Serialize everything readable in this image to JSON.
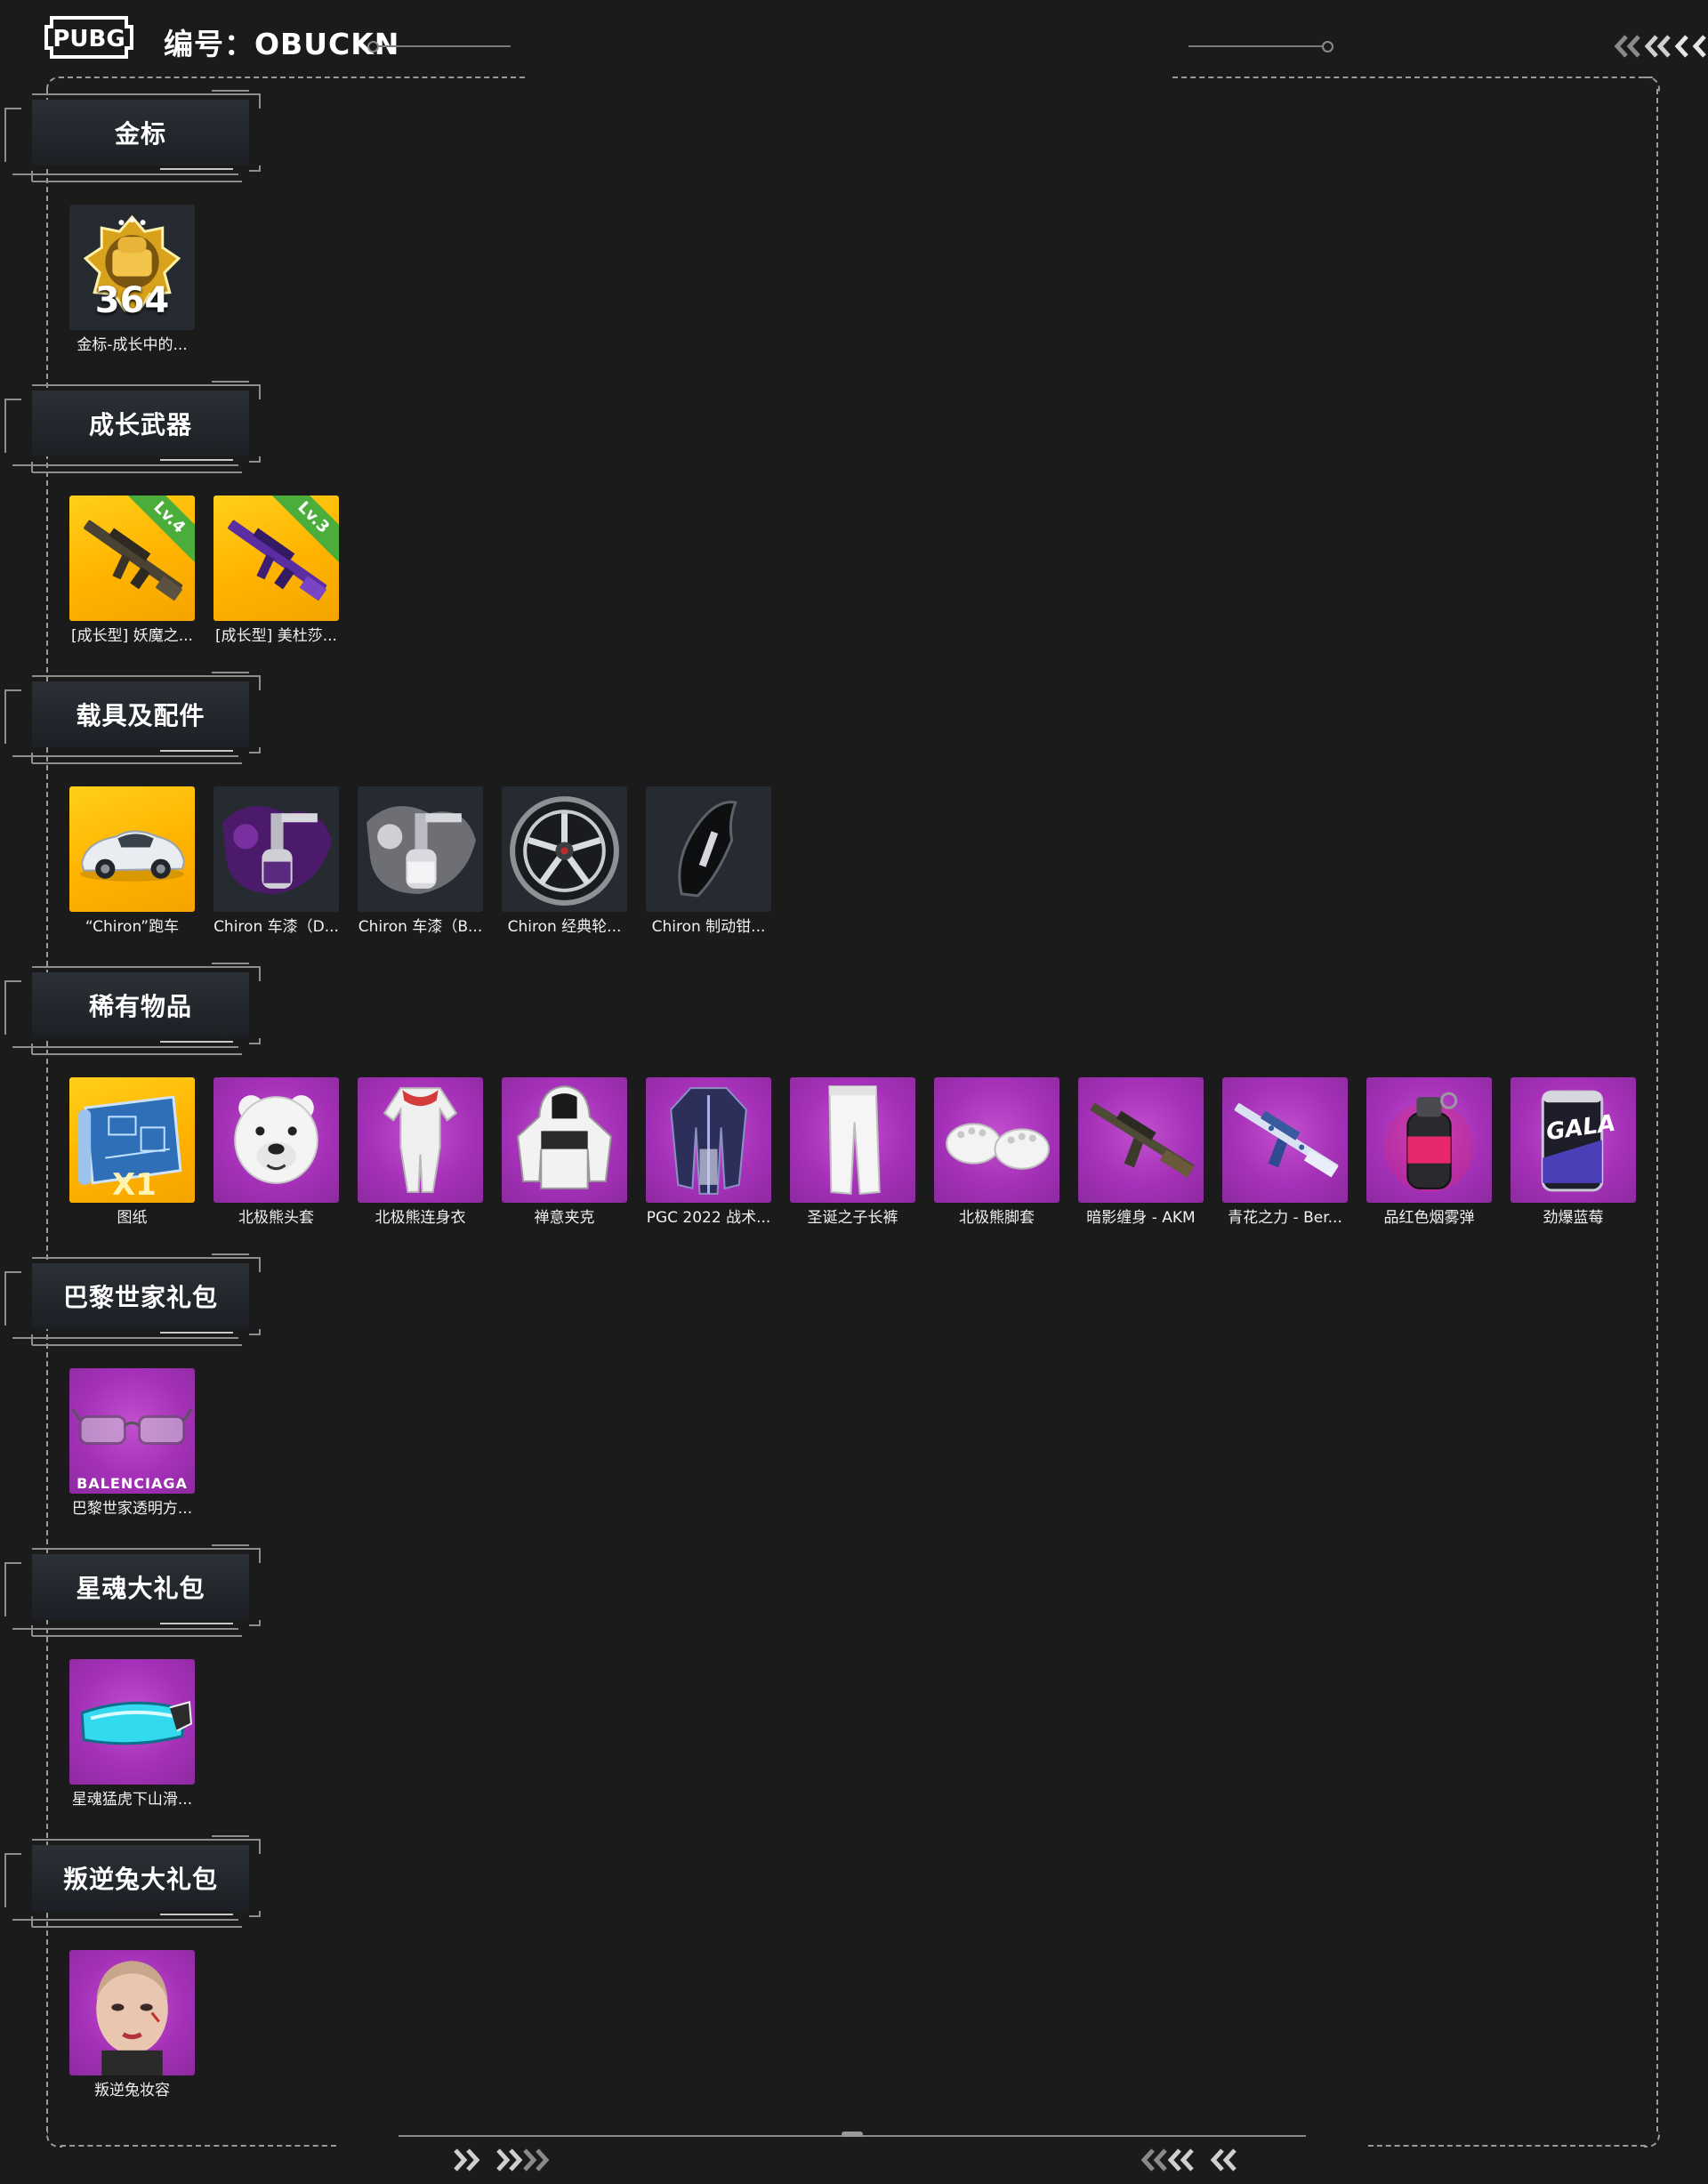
{
  "header": {
    "logo_text": "PUBG",
    "code_label": "编号：OBUCKN"
  },
  "colors": {
    "background": "#1b1b1c",
    "gold_tile": "#ffb300",
    "purple_tile": "#a531b8",
    "dark_tile": "#262b31",
    "level_badge": "#4cae3a"
  },
  "sections": [
    {
      "title": "金标",
      "items": [
        {
          "label": "金标-成长中的...",
          "bg": "dark",
          "icon": "gold-badge-icon",
          "badge_number": "364"
        }
      ]
    },
    {
      "title": "成长武器",
      "items": [
        {
          "label": "[成长型] 妖魔之...",
          "bg": "gold",
          "icon": "rifle-icon",
          "level": "Lv.4"
        },
        {
          "label": "[成长型] 美杜莎...",
          "bg": "gold",
          "icon": "rifle-purple-icon",
          "level": "Lv.3"
        }
      ]
    },
    {
      "title": "载具及配件",
      "items": [
        {
          "label": "“Chiron”跑车",
          "bg": "gold",
          "icon": "sports-car-icon"
        },
        {
          "label": "Chiron 车漆（D...",
          "bg": "dark",
          "icon": "paint-sprayer-purple-icon"
        },
        {
          "label": "Chiron 车漆（B...",
          "bg": "dark",
          "icon": "paint-sprayer-white-icon"
        },
        {
          "label": "Chiron 经典轮...",
          "bg": "dark",
          "icon": "wheel-rim-icon"
        },
        {
          "label": "Chiron 制动钳...",
          "bg": "dark",
          "icon": "brake-caliper-icon"
        }
      ]
    },
    {
      "title": "稀有物品",
      "items": [
        {
          "label": "图纸",
          "bg": "gold",
          "icon": "blueprint-icon",
          "quantity": "X1"
        },
        {
          "label": "北极熊头套",
          "bg": "purple",
          "icon": "polar-bear-head-icon"
        },
        {
          "label": "北极熊连身衣",
          "bg": "purple",
          "icon": "jumpsuit-icon"
        },
        {
          "label": "禅意夹克",
          "bg": "purple",
          "icon": "hooded-jacket-icon"
        },
        {
          "label": "PGC 2022 战术...",
          "bg": "purple",
          "icon": "tactical-coat-icon"
        },
        {
          "label": "圣诞之子长裤",
          "bg": "purple",
          "icon": "pants-icon"
        },
        {
          "label": "北极熊脚套",
          "bg": "purple",
          "icon": "bear-paws-icon"
        },
        {
          "label": "暗影缠身 - AKM",
          "bg": "purple",
          "icon": "akm-rifle-icon"
        },
        {
          "label": "青花之力 - Ber...",
          "bg": "purple",
          "icon": "porcelain-rifle-icon"
        },
        {
          "label": "品红色烟雾弹",
          "bg": "purple",
          "icon": "smoke-grenade-icon"
        },
        {
          "label": "劲爆蓝莓",
          "bg": "purple",
          "icon": "energy-can-icon",
          "can_text": "GALA"
        }
      ]
    },
    {
      "title": "巴黎世家礼包",
      "items": [
        {
          "label": "巴黎世家透明方...",
          "bg": "purple",
          "icon": "sunglasses-icon",
          "brand_text": "BALENCIAGA"
        }
      ]
    },
    {
      "title": "星魂大礼包",
      "items": [
        {
          "label": "星魂猛虎下山滑...",
          "bg": "purple",
          "icon": "ski-goggles-icon"
        }
      ]
    },
    {
      "title": "叛逆兔大礼包",
      "items": [
        {
          "label": "叛逆兔妆容",
          "bg": "purple",
          "icon": "face-makeup-icon"
        }
      ]
    }
  ]
}
